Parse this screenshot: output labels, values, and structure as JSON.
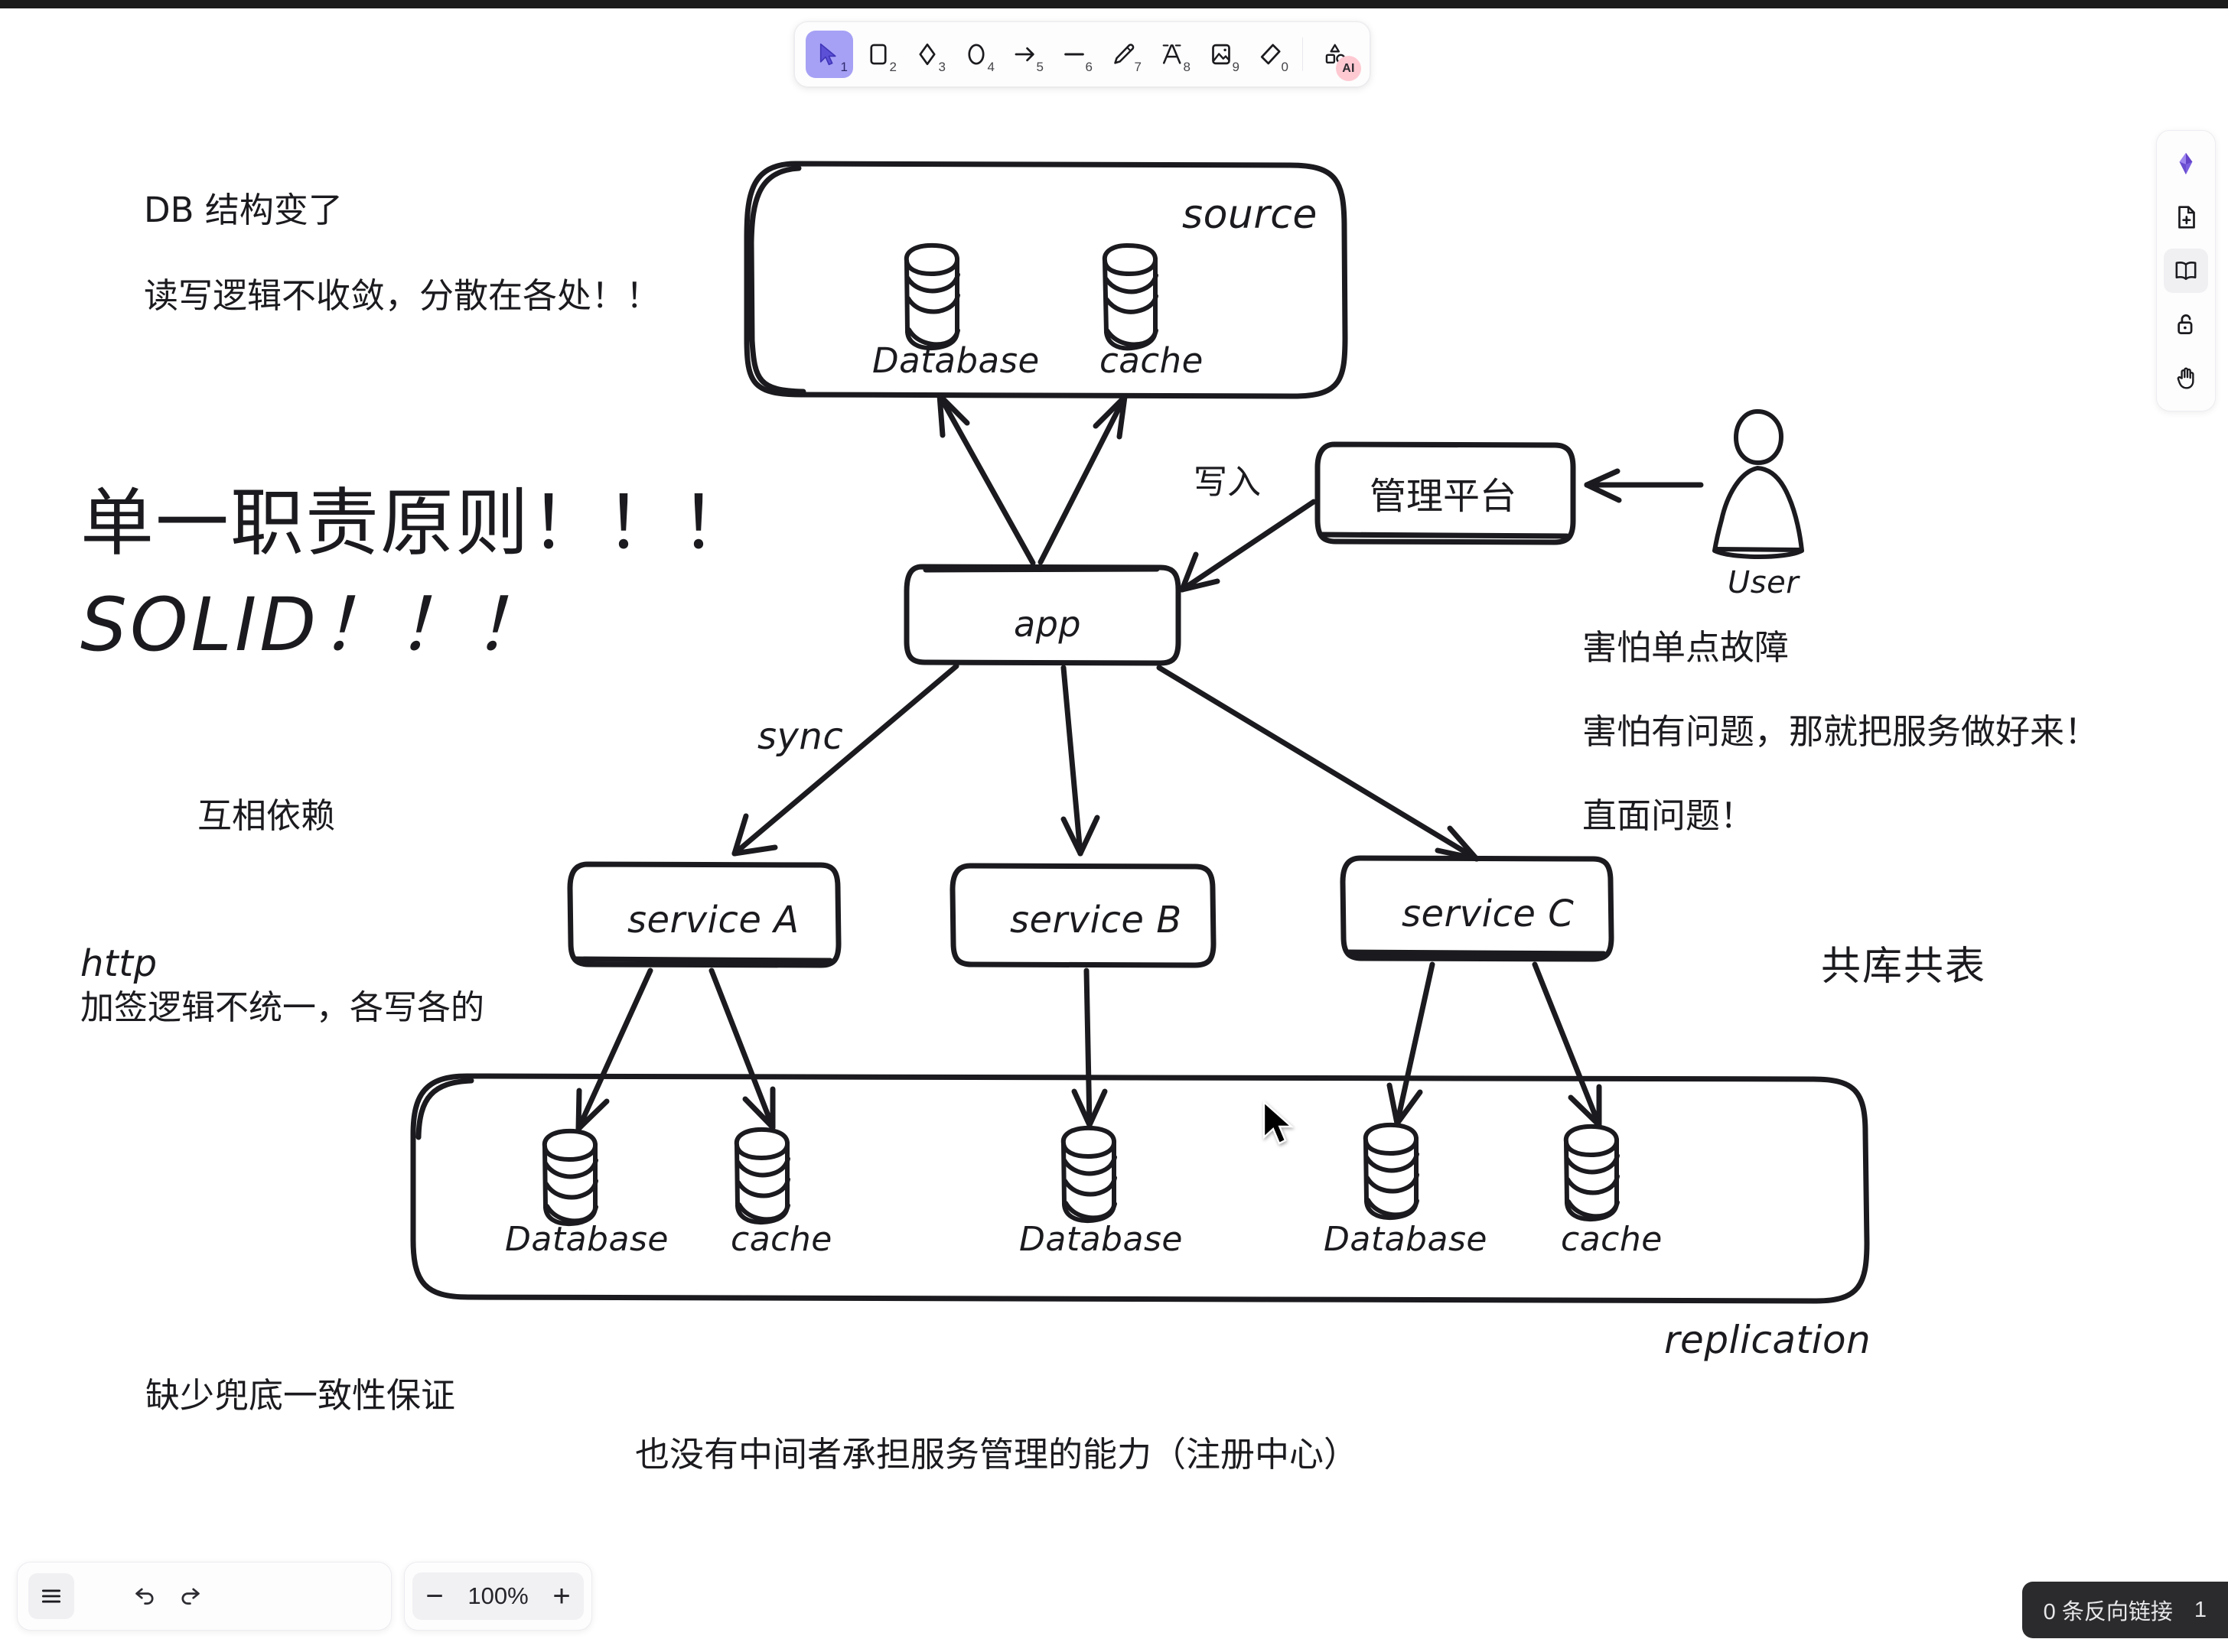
{
  "app": {
    "zoom_level": "100%"
  },
  "toolbar": {
    "tools": [
      {
        "name": "selection-tool",
        "icon": "cursor-icon",
        "shortcut": "1",
        "active": true
      },
      {
        "name": "rectangle-tool",
        "icon": "rectangle-icon",
        "shortcut": "2",
        "active": false
      },
      {
        "name": "diamond-tool",
        "icon": "diamond-icon",
        "shortcut": "3",
        "active": false
      },
      {
        "name": "ellipse-tool",
        "icon": "ellipse-icon",
        "shortcut": "4",
        "active": false
      },
      {
        "name": "arrow-tool",
        "icon": "arrow-icon",
        "shortcut": "5",
        "active": false
      },
      {
        "name": "line-tool",
        "icon": "line-icon",
        "shortcut": "6",
        "active": false
      },
      {
        "name": "draw-tool",
        "icon": "pencil-icon",
        "shortcut": "7",
        "active": false
      },
      {
        "name": "text-tool",
        "icon": "text-a-icon",
        "shortcut": "8",
        "active": false
      },
      {
        "name": "image-tool",
        "icon": "image-icon",
        "shortcut": "9",
        "active": false
      },
      {
        "name": "eraser-tool",
        "icon": "eraser-icon",
        "shortcut": "0",
        "active": false
      }
    ],
    "ai_tool": {
      "name": "shape-ai-tool",
      "icon": "shapes-icon",
      "badge": "AI"
    }
  },
  "right_rail": [
    {
      "name": "logo",
      "icon": "crystal-logo-icon",
      "active": false
    },
    {
      "name": "new-file",
      "icon": "file-plus-icon",
      "active": false
    },
    {
      "name": "read-mode",
      "icon": "book-icon",
      "active": true
    },
    {
      "name": "lock-toggle",
      "icon": "unlock-icon",
      "active": false
    },
    {
      "name": "hand-tool",
      "icon": "hand-icon",
      "active": false
    }
  ],
  "bottom_bar": {
    "menu_label": "hamburger-menu-icon",
    "undo_label": "undo-icon",
    "redo_label": "redo-icon",
    "zoom_out_label": "−",
    "zoom_in_label": "+",
    "zoom_value": "100%"
  },
  "status": {
    "backlinks": "0 条反向链接",
    "trailing": "1"
  },
  "diagram": {
    "title": "DB 结构变了",
    "notes": {
      "db_changed": "DB 结构变了",
      "rw_logic": "读写逻辑不收敛，分散在各处！！",
      "srp_line1": "单一职责原则！！！",
      "srp_line2": "SOLID！！！",
      "mutual_dep": "互相依赖",
      "http_label": "http",
      "http_note": "加签逻辑不统一，各写各的",
      "fear_spof": "害怕单点故障",
      "fear_problem": "害怕有问题，那就把服务做好来！",
      "face_problem": "直面问题！",
      "shared_db": "共库共表",
      "lack_consistency": "缺少兜底一致性保证",
      "no_registry": "也没有中间者承担服务管理的能力（注册中心）",
      "replication": "replication",
      "sync": "sync",
      "write_in": "写入"
    },
    "source_group": {
      "label": "source",
      "nodes": [
        {
          "name": "source-database",
          "label": "Database",
          "kind": "cylinder"
        },
        {
          "name": "source-cache",
          "label": "cache",
          "kind": "cylinder"
        }
      ]
    },
    "app_node": {
      "name": "app-box",
      "label": "app"
    },
    "admin_node": {
      "name": "admin-platform-box",
      "label": "管理平台"
    },
    "user_node": {
      "name": "user-actor",
      "label": "User"
    },
    "services": [
      {
        "name": "service-a-box",
        "label": "service A"
      },
      {
        "name": "service-b-box",
        "label": "service B"
      },
      {
        "name": "service-c-box",
        "label": "service C"
      }
    ],
    "replication_group": {
      "label": "replication",
      "nodes": [
        {
          "name": "svc-a-database",
          "label": "Database"
        },
        {
          "name": "svc-a-cache",
          "label": "cache"
        },
        {
          "name": "svc-b-database",
          "label": "Database"
        },
        {
          "name": "svc-c-database",
          "label": "Database"
        },
        {
          "name": "svc-c-cache",
          "label": "cache"
        }
      ]
    }
  },
  "colors": {
    "stroke": "#1b1b1f",
    "accent_purple": "#a6a1f5",
    "ai_pink": "#ffc9d2",
    "status_bg": "#2b2b2d",
    "canvas_bg": "#ffffff"
  }
}
